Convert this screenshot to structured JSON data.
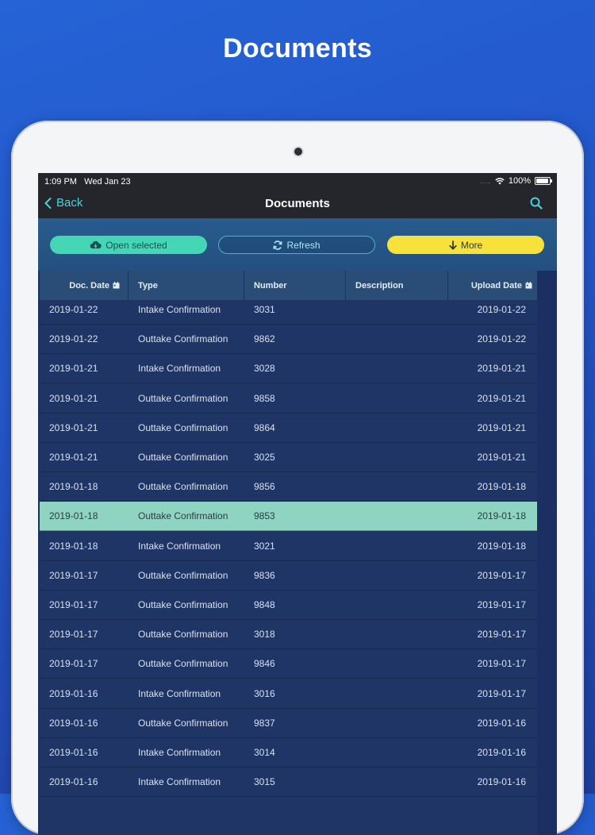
{
  "promo": {
    "title": "Documents"
  },
  "status_bar": {
    "time": "1:09 PM",
    "date": "Wed Jan 23",
    "signal": "....",
    "battery": "100%"
  },
  "nav": {
    "back_label": "Back",
    "title": "Documents"
  },
  "toolbar": {
    "open_label": "Open selected",
    "refresh_label": "Refresh",
    "more_label": "More"
  },
  "table": {
    "columns": [
      "Doc. Date",
      "Type",
      "Number",
      "Description",
      "Upload Date"
    ],
    "selected_index": 7,
    "rows": [
      {
        "doc_date": "2019-01-22",
        "type": "Intake Confirmation",
        "number": "3031",
        "description": "",
        "upload_date": "2019-01-22"
      },
      {
        "doc_date": "2019-01-22",
        "type": "Outtake Confirmation",
        "number": "9862",
        "description": "",
        "upload_date": "2019-01-22"
      },
      {
        "doc_date": "2019-01-21",
        "type": "Intake Confirmation",
        "number": "3028",
        "description": "",
        "upload_date": "2019-01-21"
      },
      {
        "doc_date": "2019-01-21",
        "type": "Outtake Confirmation",
        "number": "9858",
        "description": "",
        "upload_date": "2019-01-21"
      },
      {
        "doc_date": "2019-01-21",
        "type": "Outtake Confirmation",
        "number": "9864",
        "description": "",
        "upload_date": "2019-01-21"
      },
      {
        "doc_date": "2019-01-21",
        "type": "Outtake Confirmation",
        "number": "3025",
        "description": "",
        "upload_date": "2019-01-21"
      },
      {
        "doc_date": "2019-01-18",
        "type": "Outtake Confirmation",
        "number": "9856",
        "description": "",
        "upload_date": "2019-01-18"
      },
      {
        "doc_date": "2019-01-18",
        "type": "Outtake Confirmation",
        "number": "9853",
        "description": "",
        "upload_date": "2019-01-18"
      },
      {
        "doc_date": "2019-01-18",
        "type": "Intake Confirmation",
        "number": "3021",
        "description": "",
        "upload_date": "2019-01-18"
      },
      {
        "doc_date": "2019-01-17",
        "type": "Outtake Confirmation",
        "number": "9836",
        "description": "",
        "upload_date": "2019-01-17"
      },
      {
        "doc_date": "2019-01-17",
        "type": "Outtake Confirmation",
        "number": "9848",
        "description": "",
        "upload_date": "2019-01-17"
      },
      {
        "doc_date": "2019-01-17",
        "type": "Outtake Confirmation",
        "number": "3018",
        "description": "",
        "upload_date": "2019-01-17"
      },
      {
        "doc_date": "2019-01-17",
        "type": "Outtake Confirmation",
        "number": "9846",
        "description": "",
        "upload_date": "2019-01-17"
      },
      {
        "doc_date": "2019-01-16",
        "type": "Intake Confirmation",
        "number": "3016",
        "description": "",
        "upload_date": "2019-01-17"
      },
      {
        "doc_date": "2019-01-16",
        "type": "Outtake Confirmation",
        "number": "9837",
        "description": "",
        "upload_date": "2019-01-16"
      },
      {
        "doc_date": "2019-01-16",
        "type": "Intake Confirmation",
        "number": "3014",
        "description": "",
        "upload_date": "2019-01-16"
      },
      {
        "doc_date": "2019-01-16",
        "type": "Intake Confirmation",
        "number": "3015",
        "description": "",
        "upload_date": "2019-01-16"
      }
    ]
  },
  "icons": {
    "back": "chevron-left-icon",
    "search": "search-icon",
    "open": "cloud-download-icon",
    "refresh": "refresh-icon",
    "more": "arrow-down-icon",
    "calendar": "calendar-icon",
    "wifi": "wifi-icon",
    "battery": "battery-icon"
  },
  "colors": {
    "accent_teal": "#45d6b5",
    "accent_yellow": "#f7e23b",
    "link_cyan": "#4ad2d6",
    "selected_row": "#8fd4c0",
    "table_bg": "#1f3566",
    "header_bg": "#2a4d78"
  }
}
